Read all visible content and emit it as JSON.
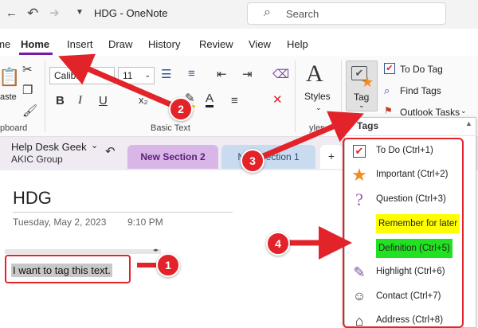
{
  "titlebar": {
    "doc_title": "HDG - OneNote",
    "search_placeholder": "Search"
  },
  "tabs": [
    {
      "label": "ome"
    },
    {
      "label": "Home"
    },
    {
      "label": "Insert"
    },
    {
      "label": "Draw"
    },
    {
      "label": "History"
    },
    {
      "label": "Review"
    },
    {
      "label": "View"
    },
    {
      "label": "Help"
    }
  ],
  "ribbon": {
    "paste_label": "aste",
    "clipboard_label": "pboard",
    "font_name": "Calibri",
    "font_size": "11",
    "basic_text_label": "Basic Text",
    "styles_label": "Styles",
    "styles_group_label": "yles",
    "tag_label": "Tag",
    "todo_tag_label": "To Do Tag",
    "find_tags_label": "Find Tags",
    "outlook_tasks_label": "Outlook Tasks"
  },
  "sections": {
    "notebook_name": "Help Desk Geek",
    "notebook_sub": "AKIC Group",
    "tab_active": "New Section 2",
    "tab_other": "New Section 1",
    "tab_plus": "+"
  },
  "page": {
    "title": "HDG",
    "date": "Tuesday, May 2, 2023",
    "time": "9:10 PM",
    "note_text": "I want to tag this text."
  },
  "tags_menu": {
    "header": "Tags",
    "items": [
      {
        "label": "To Do (Ctrl+1)",
        "icon": "checkbox-icon"
      },
      {
        "label": "Important (Ctrl+2)",
        "icon": "star-icon"
      },
      {
        "label": "Question (Ctrl+3)",
        "icon": "question-icon"
      },
      {
        "label": "Remember for later",
        "icon": "none"
      },
      {
        "label": "Definition (Ctrl+5)",
        "icon": "none"
      },
      {
        "label": "Highlight (Ctrl+6)",
        "icon": "highlighter-icon"
      },
      {
        "label": "Contact (Ctrl+7)",
        "icon": "contact-icon"
      },
      {
        "label": "Address (Ctrl+8)",
        "icon": "house-icon"
      }
    ]
  },
  "badges": [
    "1",
    "2",
    "3",
    "4"
  ],
  "colors": {
    "accent_purple": "#7719aa",
    "annotation_red": "#e2232a",
    "section_active": "#d9b6e8",
    "section_other": "#c9dbef",
    "highlight_yellow": "#ffff00",
    "highlight_green": "#22e022"
  }
}
